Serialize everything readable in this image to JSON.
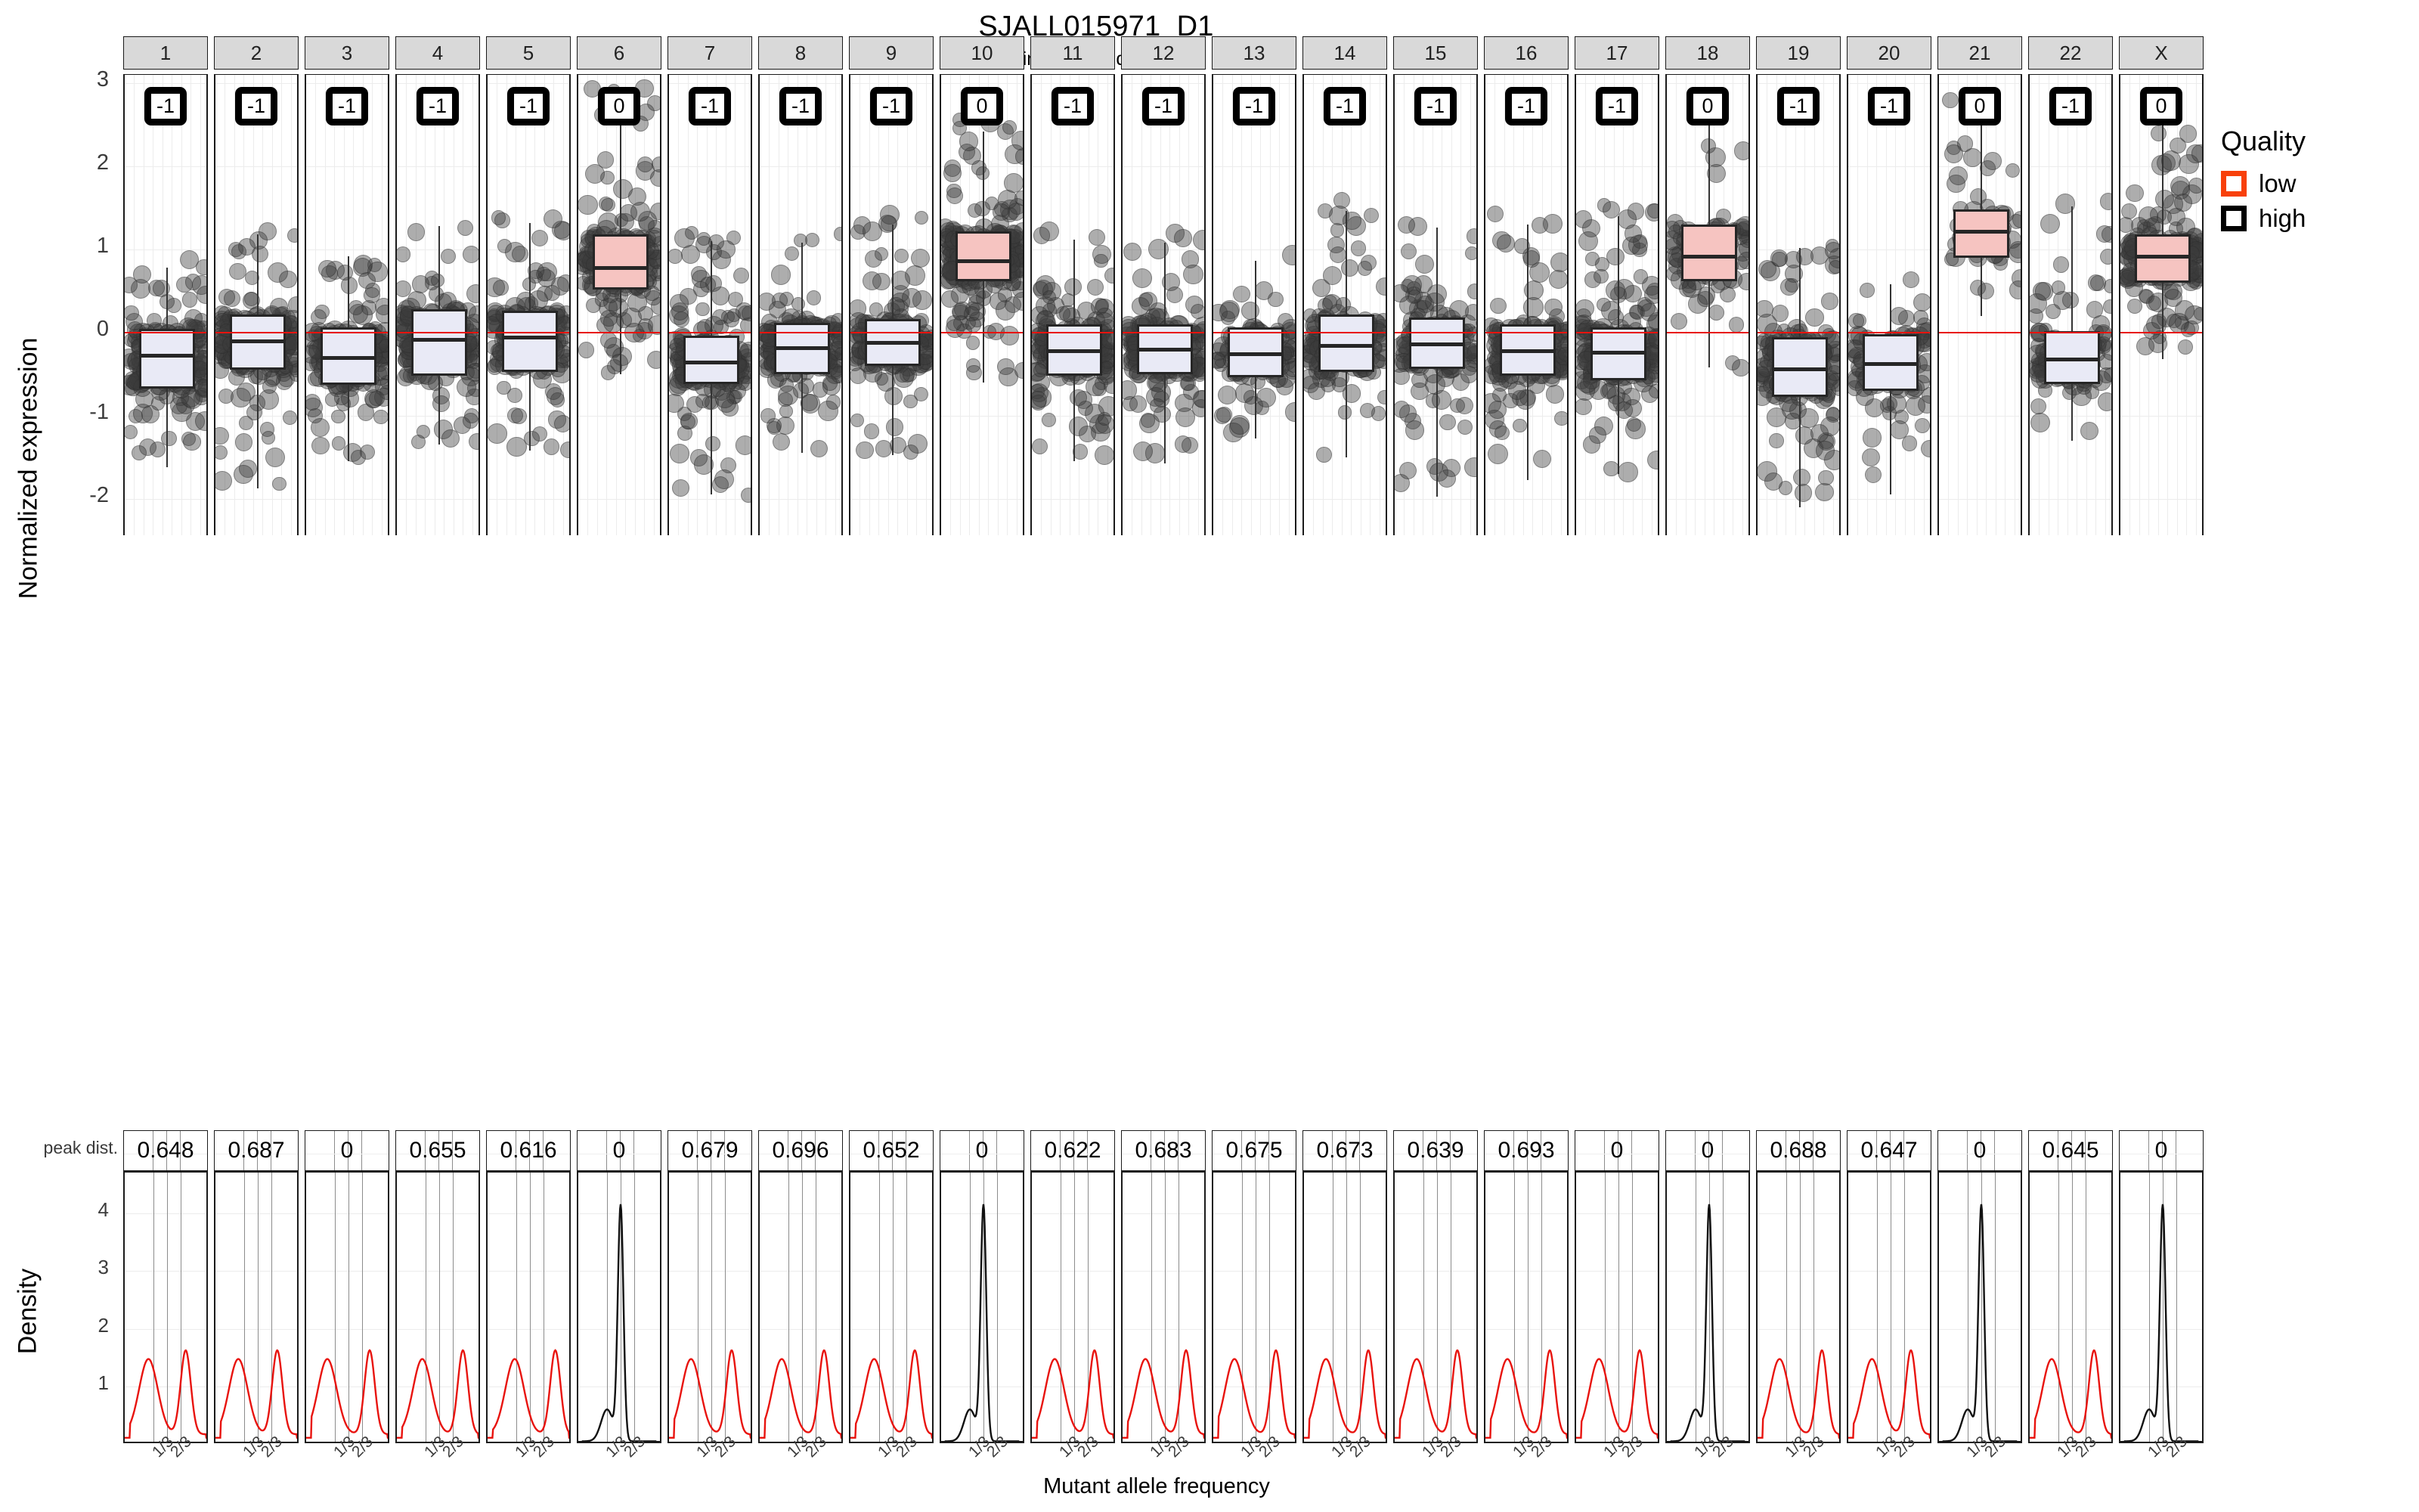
{
  "header": {
    "title": "SJALL015971_D1",
    "subtitle": "estimated gender: male"
  },
  "axes": {
    "y_top_label": "Normalized expression",
    "y_bottom_label": "Density",
    "x_label": "Mutant allele frequency",
    "y_top_ticks": [
      "3",
      "2",
      "1",
      "0",
      "-1",
      "-2"
    ],
    "y_bottom_ticks": [
      "4",
      "3",
      "2",
      "1"
    ],
    "x_ticks": [
      "1/3",
      "2/3"
    ],
    "peak_dist_label": "peak dist."
  },
  "legend": {
    "title": "Quality",
    "items": [
      {
        "label": "low",
        "color": "#f8400a"
      },
      {
        "label": "high",
        "color": "#000000"
      }
    ]
  },
  "colors": {
    "low_quality_fill": "#f6c4c1",
    "high_quality_fill": "#e9eaf6",
    "low_quality_stroke": "#f8400a",
    "zero_reference_line": "#e8130e",
    "panel_strip_bg": "#d9d9d9",
    "point_fill": "rgba(60,60,60,0.42)"
  },
  "chart_data": {
    "type": "box",
    "title": "SJALL015971_D1",
    "subtitle": "estimated gender: male",
    "xlabel": "Mutant allele frequency",
    "ylabel": "Normalized expression",
    "ylim": [
      -2.45,
      3.1
    ],
    "ylim_density": [
      0,
      4.7
    ],
    "grid": true,
    "legend_position": "right",
    "categories": [
      "1",
      "2",
      "3",
      "4",
      "5",
      "6",
      "7",
      "8",
      "9",
      "10",
      "11",
      "12",
      "13",
      "14",
      "15",
      "16",
      "17",
      "18",
      "19",
      "20",
      "21",
      "22",
      "X"
    ],
    "panels": [
      {
        "chrom": "1",
        "cn_call": "-1",
        "quality": "high",
        "peak_dist": "0.648",
        "box": {
          "q1": -0.68,
          "median": -0.28,
          "q3": 0.04,
          "lower_whisker": -1.62,
          "upper_whisker": 0.78
        },
        "density_peaks": [
          0.28,
          0.72
        ],
        "density_color": "#e8130e",
        "n_points": 210
      },
      {
        "chrom": "2",
        "cn_call": "-1",
        "quality": "high",
        "peak_dist": "0.687",
        "box": {
          "q1": -0.45,
          "median": -0.1,
          "q3": 0.22,
          "lower_whisker": -1.88,
          "upper_whisker": 1.18
        },
        "density_peaks": [
          0.27,
          0.73
        ],
        "density_color": "#e8130e",
        "n_points": 215
      },
      {
        "chrom": "3",
        "cn_call": "-1",
        "quality": "high",
        "peak_dist": "0",
        "box": {
          "q1": -0.63,
          "median": -0.3,
          "q3": 0.06,
          "lower_whisker": -1.55,
          "upper_whisker": 0.92
        },
        "density_peaks": [
          0.25,
          0.75
        ],
        "density_color": "#e8130e",
        "n_points": 190
      },
      {
        "chrom": "4",
        "cn_call": "-1",
        "quality": "high",
        "peak_dist": "0.655",
        "box": {
          "q1": -0.52,
          "median": -0.08,
          "q3": 0.28,
          "lower_whisker": -1.35,
          "upper_whisker": 1.28
        },
        "density_peaks": [
          0.3,
          0.78
        ],
        "density_color": "#e8130e",
        "n_points": 170
      },
      {
        "chrom": "5",
        "cn_call": "-1",
        "quality": "high",
        "peak_dist": "0.616",
        "box": {
          "q1": -0.48,
          "median": -0.06,
          "q3": 0.26,
          "lower_whisker": -1.42,
          "upper_whisker": 1.32
        },
        "density_peaks": [
          0.32,
          0.8
        ],
        "density_color": "#e8130e",
        "n_points": 175
      },
      {
        "chrom": "6",
        "cn_call": "0",
        "quality": "low",
        "peak_dist": "0",
        "box": {
          "q1": 0.52,
          "median": 0.78,
          "q3": 1.18,
          "lower_whisker": -0.5,
          "upper_whisker": 2.9
        },
        "density_peaks": [
          0.5
        ],
        "density_color": "#111111",
        "n_points": 200
      },
      {
        "chrom": "7",
        "cn_call": "-1",
        "quality": "high",
        "peak_dist": "0.679",
        "box": {
          "q1": -0.62,
          "median": -0.36,
          "q3": -0.04,
          "lower_whisker": -1.95,
          "upper_whisker": 1.1
        },
        "density_peaks": [
          0.26,
          0.74
        ],
        "density_color": "#e8130e",
        "n_points": 195
      },
      {
        "chrom": "8",
        "cn_call": "-1",
        "quality": "high",
        "peak_dist": "0.696",
        "box": {
          "q1": -0.5,
          "median": -0.18,
          "q3": 0.12,
          "lower_whisker": -1.45,
          "upper_whisker": 1.08
        },
        "density_peaks": [
          0.26,
          0.76
        ],
        "density_color": "#e8130e",
        "n_points": 180
      },
      {
        "chrom": "9",
        "cn_call": "-1",
        "quality": "high",
        "peak_dist": "0.652",
        "box": {
          "q1": -0.4,
          "median": -0.12,
          "q3": 0.16,
          "lower_whisker": -1.48,
          "upper_whisker": 1.3
        },
        "density_peaks": [
          0.28,
          0.76
        ],
        "density_color": "#e8130e",
        "n_points": 175
      },
      {
        "chrom": "10",
        "cn_call": "0",
        "quality": "low",
        "peak_dist": "0",
        "box": {
          "q1": 0.62,
          "median": 0.86,
          "q3": 1.22,
          "lower_whisker": -0.6,
          "upper_whisker": 2.42
        },
        "density_peaks": [
          0.5
        ],
        "density_color": "#111111",
        "n_points": 230
      },
      {
        "chrom": "11",
        "cn_call": "-1",
        "quality": "high",
        "peak_dist": "0.622",
        "box": {
          "q1": -0.52,
          "median": -0.22,
          "q3": 0.1,
          "lower_whisker": -1.55,
          "upper_whisker": 1.12
        },
        "density_peaks": [
          0.27,
          0.74
        ],
        "density_color": "#e8130e",
        "n_points": 200
      },
      {
        "chrom": "12",
        "cn_call": "-1",
        "quality": "high",
        "peak_dist": "0.683",
        "box": {
          "q1": -0.5,
          "median": -0.2,
          "q3": 0.1,
          "lower_whisker": -1.58,
          "upper_whisker": 1.08
        },
        "density_peaks": [
          0.27,
          0.75
        ],
        "density_color": "#e8130e",
        "n_points": 195
      },
      {
        "chrom": "13",
        "cn_call": "-1",
        "quality": "high",
        "peak_dist": "0.675",
        "box": {
          "q1": -0.54,
          "median": -0.26,
          "q3": 0.06,
          "lower_whisker": -1.28,
          "upper_whisker": 0.86
        },
        "density_peaks": [
          0.25,
          0.74
        ],
        "density_color": "#e8130e",
        "n_points": 120
      },
      {
        "chrom": "14",
        "cn_call": "-1",
        "quality": "high",
        "peak_dist": "0.673",
        "box": {
          "q1": -0.48,
          "median": -0.16,
          "q3": 0.22,
          "lower_whisker": -1.5,
          "upper_whisker": 1.46
        },
        "density_peaks": [
          0.26,
          0.76
        ],
        "density_color": "#e8130e",
        "n_points": 165
      },
      {
        "chrom": "15",
        "cn_call": "-1",
        "quality": "high",
        "peak_dist": "0.639",
        "box": {
          "q1": -0.44,
          "median": -0.14,
          "q3": 0.18,
          "lower_whisker": -1.98,
          "upper_whisker": 1.26
        },
        "density_peaks": [
          0.26,
          0.74
        ],
        "density_color": "#e8130e",
        "n_points": 150
      },
      {
        "chrom": "16",
        "cn_call": "-1",
        "quality": "high",
        "peak_dist": "0.693",
        "box": {
          "q1": -0.52,
          "median": -0.22,
          "q3": 0.1,
          "lower_whisker": -1.78,
          "upper_whisker": 1.3
        },
        "density_peaks": [
          0.26,
          0.76
        ],
        "density_color": "#e8130e",
        "n_points": 180
      },
      {
        "chrom": "17",
        "cn_call": "-1",
        "quality": "high",
        "peak_dist": "0",
        "box": {
          "q1": -0.58,
          "median": -0.24,
          "q3": 0.06,
          "lower_whisker": -1.7,
          "upper_whisker": 1.4
        },
        "density_peaks": [
          0.27,
          0.75
        ],
        "density_color": "#e8130e",
        "n_points": 205
      },
      {
        "chrom": "18",
        "cn_call": "0",
        "quality": "low",
        "peak_dist": "0",
        "box": {
          "q1": 0.62,
          "median": 0.92,
          "q3": 1.3,
          "lower_whisker": -0.42,
          "upper_whisker": 2.58
        },
        "density_peaks": [
          0.5
        ],
        "density_color": "#111111",
        "n_points": 95
      },
      {
        "chrom": "19",
        "cn_call": "-1",
        "quality": "high",
        "peak_dist": "0.688",
        "box": {
          "q1": -0.78,
          "median": -0.44,
          "q3": -0.06,
          "lower_whisker": -2.1,
          "upper_whisker": 1.02
        },
        "density_peaks": [
          0.26,
          0.76
        ],
        "density_color": "#e8130e",
        "n_points": 190
      },
      {
        "chrom": "20",
        "cn_call": "-1",
        "quality": "high",
        "peak_dist": "0.647",
        "box": {
          "q1": -0.7,
          "median": -0.38,
          "q3": -0.02,
          "lower_whisker": -1.95,
          "upper_whisker": 0.58
        },
        "density_peaks": [
          0.28,
          0.74
        ],
        "density_color": "#e8130e",
        "n_points": 110
      },
      {
        "chrom": "21",
        "cn_call": "0",
        "quality": "low",
        "peak_dist": "0",
        "box": {
          "q1": 0.9,
          "median": 1.22,
          "q3": 1.48,
          "lower_whisker": 0.2,
          "upper_whisker": 2.72
        },
        "density_peaks": [
          0.5
        ],
        "density_color": "#111111",
        "n_points": 55
      },
      {
        "chrom": "22",
        "cn_call": "-1",
        "quality": "high",
        "peak_dist": "0.645",
        "box": {
          "q1": -0.62,
          "median": -0.32,
          "q3": 0.02,
          "lower_whisker": -1.3,
          "upper_whisker": 1.52
        },
        "density_peaks": [
          0.26,
          0.76
        ],
        "density_color": "#e8130e",
        "n_points": 120
      },
      {
        "chrom": "X",
        "cn_call": "0",
        "quality": "low",
        "peak_dist": "0",
        "box": {
          "q1": 0.6,
          "median": 0.92,
          "q3": 1.18,
          "lower_whisker": -0.32,
          "upper_whisker": 2.72
        },
        "density_peaks": [
          0.5
        ],
        "density_color": "#111111",
        "n_points": 200
      }
    ]
  }
}
